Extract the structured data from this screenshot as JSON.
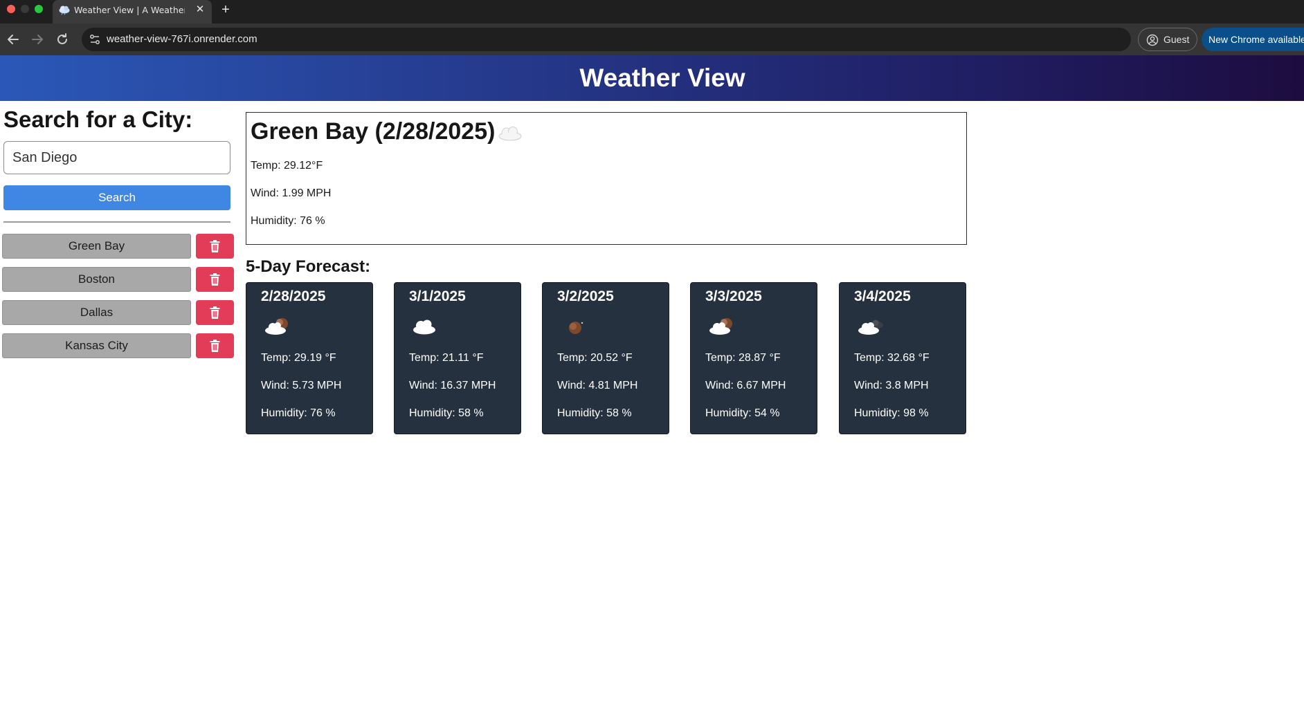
{
  "browser": {
    "tab_title": "Weather View | A Weather Dashboard",
    "tab_close": "✕",
    "new_tab": "+",
    "url": "weather-view-767i.onrender.com",
    "guest_label": "Guest",
    "update_label": "New Chrome available"
  },
  "header": {
    "title": "Weather View"
  },
  "search": {
    "heading": "Search for a City:",
    "input_value": "San Diego",
    "button_label": "Search"
  },
  "history": [
    {
      "city": "Green Bay"
    },
    {
      "city": "Boston"
    },
    {
      "city": "Dallas"
    },
    {
      "city": "Kansas City"
    }
  ],
  "current": {
    "title": "Green Bay (2/28/2025)",
    "icon": "cloud-icon",
    "temp": "Temp: 29.12°F",
    "wind": "Wind: 1.99 MPH",
    "humidity": "Humidity: 76 %"
  },
  "forecast": {
    "heading": "5-Day Forecast:",
    "days": [
      {
        "date": "2/28/2025",
        "icon": "cloud-moon-icon",
        "temp": "Temp: 29.19 °F",
        "wind": "Wind: 5.73 MPH",
        "humidity": "Humidity: 76 %"
      },
      {
        "date": "3/1/2025",
        "icon": "cloud-icon",
        "temp": "Temp: 21.11 °F",
        "wind": "Wind: 16.37 MPH",
        "humidity": "Humidity: 58 %"
      },
      {
        "date": "3/2/2025",
        "icon": "moon-icon",
        "temp": "Temp: 20.52 °F",
        "wind": "Wind: 4.81 MPH",
        "humidity": "Humidity: 58 %"
      },
      {
        "date": "3/3/2025",
        "icon": "cloud-moon-icon",
        "temp": "Temp: 28.87 °F",
        "wind": "Wind: 6.67 MPH",
        "humidity": "Humidity: 54 %"
      },
      {
        "date": "3/4/2025",
        "icon": "broken-clouds-icon",
        "temp": "Temp: 32.68 °F",
        "wind": "Wind: 3.8 MPH",
        "humidity": "Humidity: 98 %"
      }
    ]
  },
  "colors": {
    "search_button": "#3f87e2",
    "delete_button": "#e23c58",
    "history_item": "#a8a8a8",
    "forecast_card": "#263140"
  }
}
